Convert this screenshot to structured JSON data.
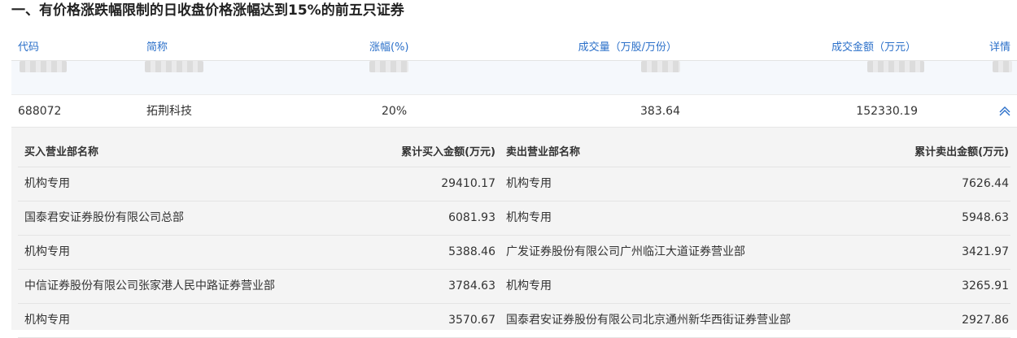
{
  "section": {
    "title": "一、有价格涨跌幅限制的日收盘价格涨幅达到15%的前五只证券"
  },
  "table": {
    "headers": {
      "code": "代码",
      "name": "简称",
      "change": "涨幅(%)",
      "volume": "成交量（万股/万份）",
      "amount": "成交金额（万元）",
      "detail": "详情"
    },
    "rows": [
      {
        "code": "688072",
        "name": "拓荆科技",
        "change": "20%",
        "volume": "383.64",
        "amount": "152330.19",
        "detail_icon": "chevron-up-icon"
      }
    ]
  },
  "detail": {
    "headers": {
      "buy_name": "买入营业部名称",
      "buy_amount": "累计买入金额(万元)",
      "sell_name": "卖出营业部名称",
      "sell_amount": "累计卖出金额(万元)"
    },
    "rows": [
      {
        "buy_name": "机构专用",
        "buy_amount": "29410.17",
        "sell_name": "机构专用",
        "sell_amount": "7626.44"
      },
      {
        "buy_name": "国泰君安证券股份有限公司总部",
        "buy_amount": "6081.93",
        "sell_name": "机构专用",
        "sell_amount": "5948.63"
      },
      {
        "buy_name": "机构专用",
        "buy_amount": "5388.46",
        "sell_name": "广发证券股份有限公司广州临江大道证券营业部",
        "sell_amount": "3421.97"
      },
      {
        "buy_name": "中信证券股份有限公司张家港人民中路证券营业部",
        "buy_amount": "3784.63",
        "sell_name": "机构专用",
        "sell_amount": "3265.91"
      },
      {
        "buy_name": "机构专用",
        "buy_amount": "3570.67",
        "sell_name": "国泰君安证券股份有限公司北京通州新华西街证券营业部",
        "sell_amount": "2927.86"
      }
    ]
  },
  "colors": {
    "header_text": "#2a6fc9",
    "chevron": "#2a6fc9",
    "detail_bg": "#f4f4f4"
  }
}
